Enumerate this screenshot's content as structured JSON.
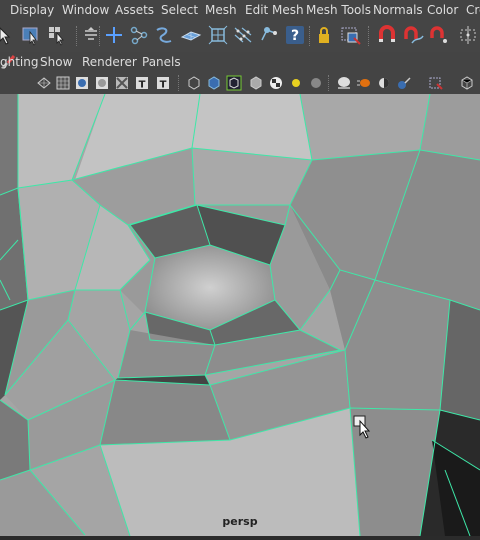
{
  "menubar": {
    "items": [
      "Display",
      "Window",
      "Assets",
      "Select",
      "Mesh",
      "Edit Mesh",
      "Mesh Tools",
      "Normals",
      "Color",
      "Cre"
    ]
  },
  "panel_menu": {
    "items": [
      "ghting",
      "Show",
      "Renderer",
      "Panels"
    ]
  },
  "viewport": {
    "camera_label": "persp"
  },
  "colors": {
    "wireframe": "#3ee8a8",
    "menubar_bg": "#444444",
    "menu_text": "#dddddd",
    "accent_highlight": "#d8b820"
  },
  "icons": {
    "toolbar": [
      "select-tool-icon",
      "lasso-select-icon",
      "paint-select-icon",
      "snap-toggle-icon",
      "move-tool-icon",
      "scale-tool-icon",
      "curve-tool-icon",
      "poly-plane-icon",
      "poly-cube-icon",
      "multi-cut-icon",
      "component-icon",
      "help-icon",
      "lock-icon",
      "select-camera-icon",
      "magnet-icon",
      "magnet-curve-icon",
      "magnet-point-icon",
      "snap-grid-icon"
    ],
    "panel": [
      "brush-icon",
      "wireframe-icon",
      "grid-icon",
      "shaded-icon",
      "textured-icon",
      "xray-icon",
      "text-icon",
      "isolate-icon",
      "cube-icon",
      "smooth-icon",
      "texture-checker-icon",
      "light-icon",
      "sphere-icon",
      "shadow-icon",
      "ambient-occlusion-icon",
      "motion-blur-icon",
      "antialias-icon",
      "resolution-gate-icon",
      "camera-icon"
    ]
  }
}
